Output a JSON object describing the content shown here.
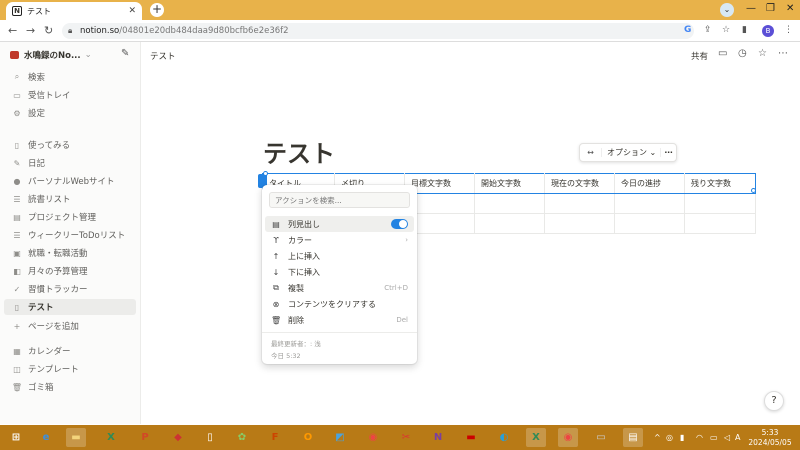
{
  "browser": {
    "tab_title": "テスト",
    "tab_favicon": "N",
    "url_host": "notion.so",
    "url_path": "/04801e20db484daa9d80bcfb6e2e36f2",
    "profile_initial": "B"
  },
  "sidebar": {
    "workspace": "水鳴録のNo...",
    "top_items": [
      {
        "icon": "search-icon",
        "label": "検索"
      },
      {
        "icon": "inbox-icon",
        "label": "受信トレイ"
      },
      {
        "icon": "gear-icon",
        "label": "設定"
      }
    ],
    "pages": [
      {
        "icon": "page-icon",
        "label": "使ってみる"
      },
      {
        "icon": "pen-icon",
        "label": "日記"
      },
      {
        "icon": "person-icon",
        "label": "パーソナルWebサイト"
      },
      {
        "icon": "list-icon",
        "label": "読書リスト"
      },
      {
        "icon": "project-icon",
        "label": "プロジェクト管理"
      },
      {
        "icon": "list-icon",
        "label": "ウィークリーToDoリスト"
      },
      {
        "icon": "briefcase-icon",
        "label": "就職・転職活動"
      },
      {
        "icon": "wallet-icon",
        "label": "月々の予算管理"
      },
      {
        "icon": "check-icon",
        "label": "習慣トラッカー"
      },
      {
        "icon": "page-icon",
        "label": "テスト"
      }
    ],
    "add_page": "ページを追加",
    "bottom_items": [
      {
        "icon": "calendar-icon",
        "label": "カレンダー"
      },
      {
        "icon": "template-icon",
        "label": "テンプレート"
      },
      {
        "icon": "trash-icon",
        "label": "ゴミ箱"
      }
    ]
  },
  "topbar": {
    "breadcrumb": "テスト",
    "share": "共有"
  },
  "page": {
    "title": "テスト",
    "options_label": "オプション"
  },
  "table": {
    "headers": [
      "タイトル",
      "〆切り",
      "目標文字数",
      "開始文字数",
      "現在の文字数",
      "今日の進捗",
      "残り文字数"
    ]
  },
  "menu": {
    "search_placeholder": "アクションを検索...",
    "items": [
      {
        "icon": "table-icon",
        "label": "列見出し",
        "toggle": true
      },
      {
        "icon": "paint-icon",
        "label": "カラー",
        "shortcut": "›"
      },
      {
        "icon": "arrow-up-icon",
        "label": "上に挿入"
      },
      {
        "icon": "arrow-down-icon",
        "label": "下に挿入"
      },
      {
        "icon": "duplicate-icon",
        "label": "複製",
        "shortcut": "Ctrl+D"
      },
      {
        "icon": "clear-icon",
        "label": "コンテンツをクリアする"
      },
      {
        "icon": "trash-icon",
        "label": "削除",
        "shortcut": "Del"
      }
    ],
    "footer_edited": "最終更新者：: 浅",
    "footer_time": "今日 5:32"
  },
  "taskbar": {
    "clock_time": "5:33",
    "clock_date": "2024/05/05"
  }
}
